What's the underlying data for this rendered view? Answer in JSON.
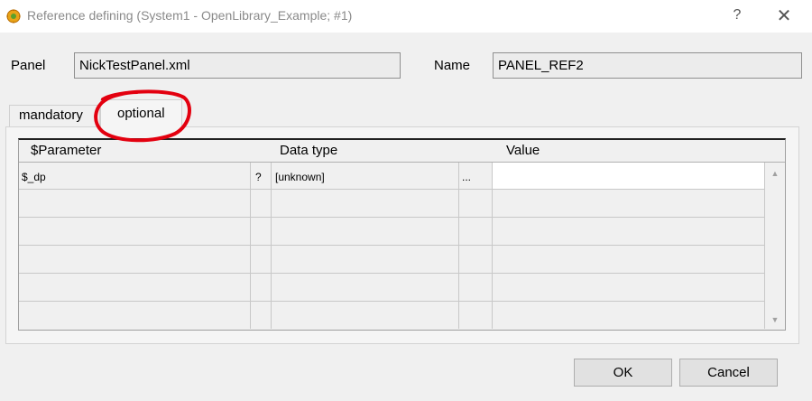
{
  "window": {
    "title": "Reference defining (System1 - OpenLibrary_Example; #1)",
    "help_icon": "?",
    "close_icon": "✕"
  },
  "form": {
    "panel_label": "Panel",
    "panel_value": "NickTestPanel.xml",
    "name_label": "Name",
    "name_value": "PANEL_REF2"
  },
  "tabs": [
    {
      "label": "mandatory",
      "selected": false
    },
    {
      "label": "optional",
      "selected": true
    }
  ],
  "table": {
    "columns": [
      "$Parameter",
      "Data type",
      "Value"
    ],
    "rows": [
      {
        "parameter": "$_dp",
        "flag": "?",
        "data_type": "[unknown]",
        "more": "...",
        "value": ""
      }
    ]
  },
  "buttons": {
    "ok": "OK",
    "cancel": "Cancel"
  },
  "colors": {
    "annotation_circle": "#e3000f",
    "window_background": "#f0f0f0"
  }
}
